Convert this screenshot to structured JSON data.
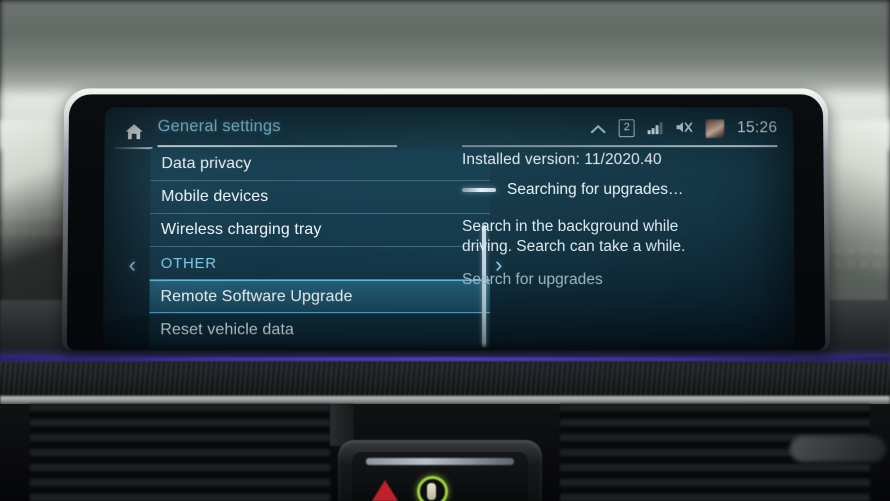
{
  "screen": {
    "home_icon": "home-icon",
    "title": "General settings",
    "statusbar": {
      "chevron_up_icon": "chevron-up-icon",
      "notification_count": "2",
      "signal_icon": "signal-bars-icon",
      "mute_icon": "speaker-muted-icon",
      "avatar_icon": "driver-avatar-icon",
      "clock": "15:26"
    },
    "nav": {
      "prev_icon": "chevron-left-icon",
      "next_icon": "chevron-right-icon"
    },
    "list": {
      "items": [
        {
          "label": "Data privacy",
          "type": "item",
          "selected": false
        },
        {
          "label": "Mobile devices",
          "type": "item",
          "selected": false
        },
        {
          "label": "Wireless charging tray",
          "type": "item",
          "selected": false
        },
        {
          "label": "OTHER",
          "type": "section",
          "selected": false
        },
        {
          "label": "Remote Software Upgrade",
          "type": "item",
          "selected": true
        },
        {
          "label": "Reset vehicle data",
          "type": "item",
          "selected": false
        }
      ]
    },
    "detail": {
      "installed_version": "Installed version: 11/2020.40",
      "searching_status": "Searching for upgrades…",
      "hint": "Search in the background while driving. Search can take a while.",
      "action_label": "Search for upgrades"
    },
    "colors": {
      "accent_cyan": "#8fd2ee",
      "selected_border": "#63b9dc",
      "text_primary": "#f0f6f9",
      "text_muted": "#9fb7c4",
      "screen_bg": "#143444"
    }
  },
  "vehicle": {
    "hazard_button_icon": "hazard-triangle-icon",
    "status_ring_icon": "green-status-ring-icon",
    "ambient_light_color": "#5a4cd6"
  }
}
